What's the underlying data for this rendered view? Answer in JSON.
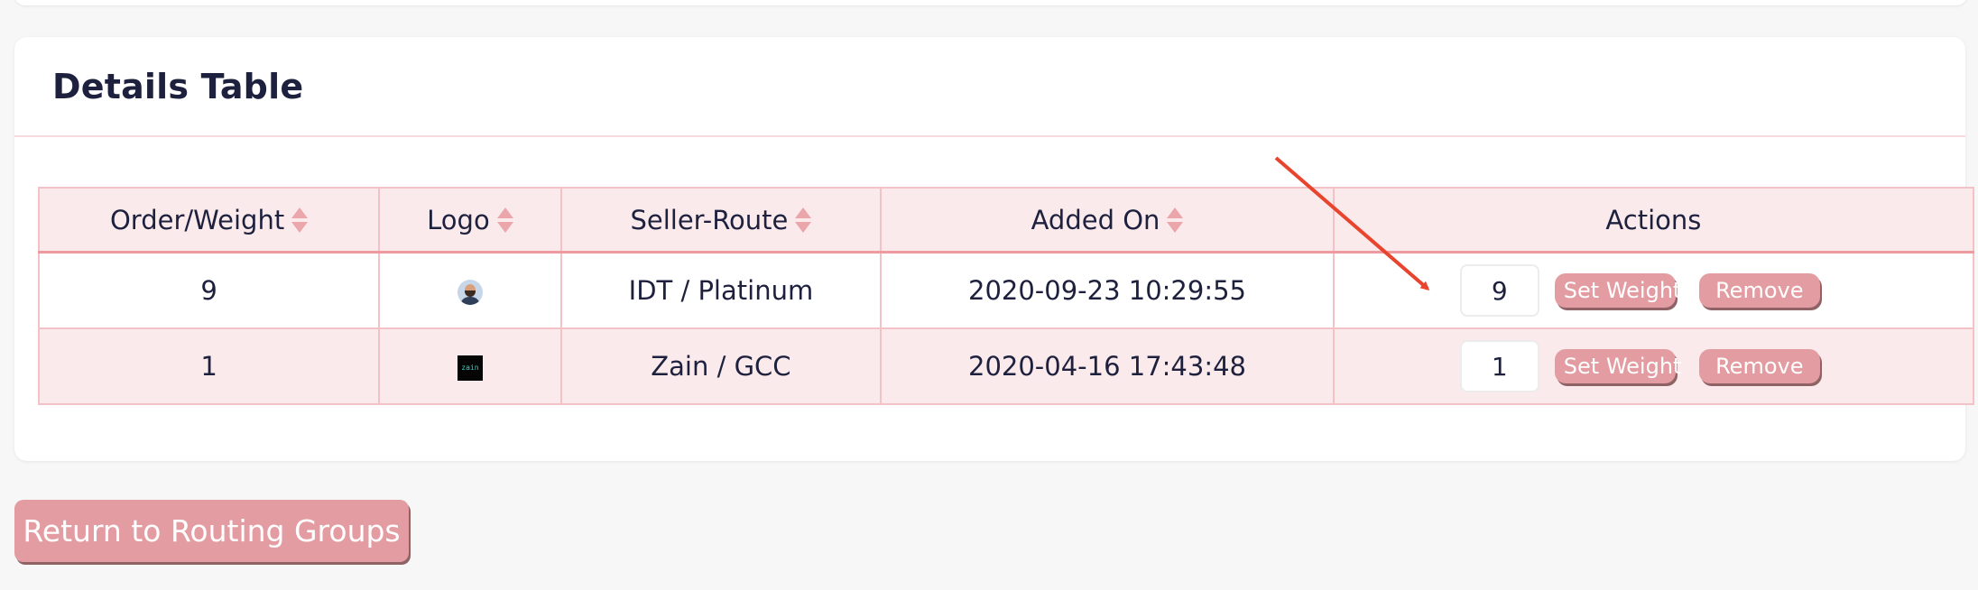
{
  "card": {
    "title": "Details Table"
  },
  "table": {
    "columns": [
      {
        "label": "Order/Weight",
        "sortable": true
      },
      {
        "label": "Logo",
        "sortable": true
      },
      {
        "label": "Seller-Route",
        "sortable": true
      },
      {
        "label": "Added On",
        "sortable": true
      },
      {
        "label": "Actions",
        "sortable": false
      }
    ],
    "rows": [
      {
        "order_weight": "9",
        "logo": "avatar-logo",
        "seller_route": "IDT / Platinum",
        "added_on": "2020-09-23 10:29:55",
        "weight_input_value": "9",
        "set_weight_label": "Set Weight",
        "remove_label": "Remove"
      },
      {
        "order_weight": "1",
        "logo": "zain-logo",
        "logo_text": "zain",
        "seller_route": "Zain / GCC",
        "added_on": "2020-04-16 17:43:48",
        "weight_input_value": "1",
        "set_weight_label": "Set Weight",
        "remove_label": "Remove"
      }
    ]
  },
  "footer": {
    "return_label": "Return to Routing Groups"
  },
  "colors": {
    "accent": "#e39ca1",
    "header_bg": "#faeaeb",
    "border": "#f2c2c6",
    "title": "#1e213e",
    "annotation_arrow": "#e8442e"
  }
}
